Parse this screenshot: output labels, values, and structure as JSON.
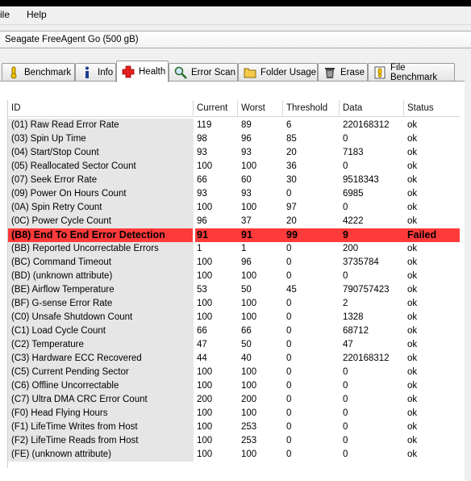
{
  "menu": {
    "file_label": "ile",
    "help_label": "Help"
  },
  "drive": {
    "label": "Seagate FreeAgent Go     (500 gB)"
  },
  "tabs": [
    {
      "label": "Benchmark",
      "icon": "benchmark-icon"
    },
    {
      "label": "Info",
      "icon": "info-icon"
    },
    {
      "label": "Health",
      "icon": "health-cross-icon"
    },
    {
      "label": "Error Scan",
      "icon": "magnifier-icon"
    },
    {
      "label": "Folder Usage",
      "icon": "folder-icon"
    },
    {
      "label": "Erase",
      "icon": "trash-icon"
    },
    {
      "label": "File Benchmark",
      "icon": "file-benchmark-icon"
    }
  ],
  "colors": {
    "failed_row": "#ff3a3a",
    "id_column_bg": "#e6e6e6"
  },
  "table": {
    "headers": [
      "ID",
      "Current",
      "Worst",
      "Threshold",
      "Data",
      "Status"
    ],
    "rows": [
      [
        "(01) Raw Read Error Rate",
        "119",
        "89",
        "6",
        "220168312",
        "ok"
      ],
      [
        "(03) Spin Up Time",
        "98",
        "96",
        "85",
        "0",
        "ok"
      ],
      [
        "(04) Start/Stop Count",
        "93",
        "93",
        "20",
        "7183",
        "ok"
      ],
      [
        "(05) Reallocated Sector Count",
        "100",
        "100",
        "36",
        "0",
        "ok"
      ],
      [
        "(07) Seek Error Rate",
        "66",
        "60",
        "30",
        "9518343",
        "ok"
      ],
      [
        "(09) Power On Hours Count",
        "93",
        "93",
        "0",
        "6985",
        "ok"
      ],
      [
        "(0A) Spin Retry Count",
        "100",
        "100",
        "97",
        "0",
        "ok"
      ],
      [
        "(0C) Power Cycle Count",
        "96",
        "37",
        "20",
        "4222",
        "ok"
      ],
      [
        "(B8) End To End Error Detection",
        "91",
        "91",
        "99",
        "9",
        "Failed"
      ],
      [
        "(BB) Reported Uncorrectable Errors",
        "1",
        "1",
        "0",
        "200",
        "ok"
      ],
      [
        "(BC) Command Timeout",
        "100",
        "96",
        "0",
        "3735784",
        "ok"
      ],
      [
        "(BD) (unknown attribute)",
        "100",
        "100",
        "0",
        "0",
        "ok"
      ],
      [
        "(BE) Airflow Temperature",
        "53",
        "50",
        "45",
        "790757423",
        "ok"
      ],
      [
        "(BF) G-sense Error Rate",
        "100",
        "100",
        "0",
        "2",
        "ok"
      ],
      [
        "(C0) Unsafe Shutdown Count",
        "100",
        "100",
        "0",
        "1328",
        "ok"
      ],
      [
        "(C1) Load Cycle Count",
        "66",
        "66",
        "0",
        "68712",
        "ok"
      ],
      [
        "(C2) Temperature",
        "47",
        "50",
        "0",
        "47",
        "ok"
      ],
      [
        "(C3) Hardware ECC Recovered",
        "44",
        "40",
        "0",
        "220168312",
        "ok"
      ],
      [
        "(C5) Current Pending Sector",
        "100",
        "100",
        "0",
        "0",
        "ok"
      ],
      [
        "(C6) Offline Uncorrectable",
        "100",
        "100",
        "0",
        "0",
        "ok"
      ],
      [
        "(C7) Ultra DMA CRC Error Count",
        "200",
        "200",
        "0",
        "0",
        "ok"
      ],
      [
        "(F0) Head Flying Hours",
        "100",
        "100",
        "0",
        "0",
        "ok"
      ],
      [
        "(F1) LifeTime Writes from Host",
        "100",
        "253",
        "0",
        "0",
        "ok"
      ],
      [
        "(F2) LifeTime Reads from Host",
        "100",
        "253",
        "0",
        "0",
        "ok"
      ],
      [
        "(FE) (unknown attribute)",
        "100",
        "100",
        "0",
        "0",
        "ok"
      ]
    ]
  }
}
